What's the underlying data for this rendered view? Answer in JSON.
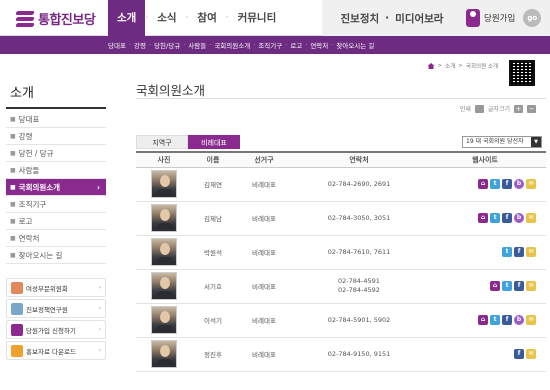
{
  "header": {
    "logo_text": "통합진보당",
    "nav": [
      "소개",
      "소식",
      "참여",
      "커뮤니티"
    ],
    "nav_active_index": 0,
    "nav_secondary": [
      "진보정치",
      "미디어보라"
    ],
    "join_label": "당원가입",
    "go_label": "go"
  },
  "subnav": {
    "items": [
      "당대표",
      "강령",
      "당헌/당규",
      "사람들",
      "국회의원소개",
      "조직기구",
      "로고",
      "연락처",
      "찾아오시는 길"
    ]
  },
  "breadcrumb": [
    "소개",
    "국회의원 소개"
  ],
  "sidebar": {
    "title": "소개",
    "items": [
      {
        "label": "당대표"
      },
      {
        "label": "강령"
      },
      {
        "label": "당헌 / 당규"
      },
      {
        "label": "사람들"
      },
      {
        "label": "국회의원소개"
      },
      {
        "label": "조직기구"
      },
      {
        "label": "로고"
      },
      {
        "label": "연락처"
      },
      {
        "label": "찾아오시는 길"
      }
    ],
    "active_index": 4,
    "banners": [
      {
        "label": "여성부문위원회"
      },
      {
        "label": "진보정책연구원"
      },
      {
        "label": "당원가입 신청하기"
      },
      {
        "label": "홍보자료 다운로드"
      }
    ]
  },
  "main": {
    "title": "국회의원소개",
    "tools": {
      "print_label": "인쇄",
      "font_label": "글자크기"
    },
    "tabs": [
      "지역구",
      "비례대표"
    ],
    "active_tab": 1,
    "session_select": "19 대 국회의원 당선자",
    "table": {
      "headers": [
        "사진",
        "이름",
        "선거구",
        "연락처",
        "웹사이트"
      ],
      "rows": [
        {
          "name": "김재연",
          "district": "비례대표",
          "contact": [
            "02-784-2690, 2691"
          ],
          "sites": [
            "home",
            "tw",
            "fb",
            "blog",
            "mail"
          ]
        },
        {
          "name": "김제남",
          "district": "비례대표",
          "contact": [
            "02-784-3050, 3051"
          ],
          "sites": [
            "home",
            "tw",
            "fb",
            "blog",
            "mail"
          ]
        },
        {
          "name": "박원석",
          "district": "비례대표",
          "contact": [
            "02-784-7610, 7611"
          ],
          "sites": [
            "tw",
            "fb",
            "mail"
          ]
        },
        {
          "name": "서기호",
          "district": "비례대표",
          "contact": [
            "02-784-4591",
            "02-784-4592"
          ],
          "sites": [
            "home",
            "tw",
            "fb",
            "mail"
          ]
        },
        {
          "name": "이석기",
          "district": "비례대표",
          "contact": [
            "02-784-5901, 5902"
          ],
          "sites": [
            "home",
            "tw",
            "fb",
            "blog",
            "mail"
          ]
        },
        {
          "name": "정진후",
          "district": "비례대표",
          "contact": [
            "02-784-9150, 9151"
          ],
          "sites": [
            "fb",
            "mail"
          ]
        }
      ]
    }
  },
  "colors": {
    "accent": "#6e2b82",
    "accent_light": "#8b2a8e"
  }
}
